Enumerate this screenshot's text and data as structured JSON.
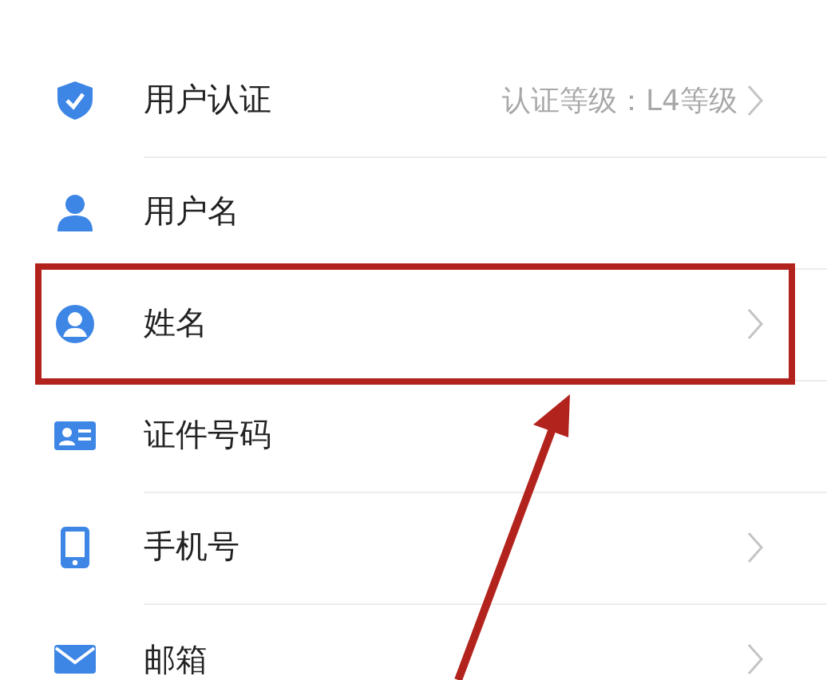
{
  "rows": [
    {
      "kind": "shield",
      "label": "用户认证",
      "value": "认证等级：L4等级",
      "chevron": true,
      "highlighted": false
    },
    {
      "kind": "person",
      "label": "用户名",
      "chevron": false,
      "highlighted": false
    },
    {
      "kind": "avatar",
      "label": "姓名",
      "chevron": true,
      "highlighted": true
    },
    {
      "kind": "id-card",
      "label": "证件号码",
      "chevron": false,
      "highlighted": false
    },
    {
      "kind": "phone",
      "label": "手机号",
      "chevron": true,
      "highlighted": false
    },
    {
      "kind": "mail",
      "label": "邮箱",
      "chevron": true,
      "highlighted": false
    }
  ]
}
